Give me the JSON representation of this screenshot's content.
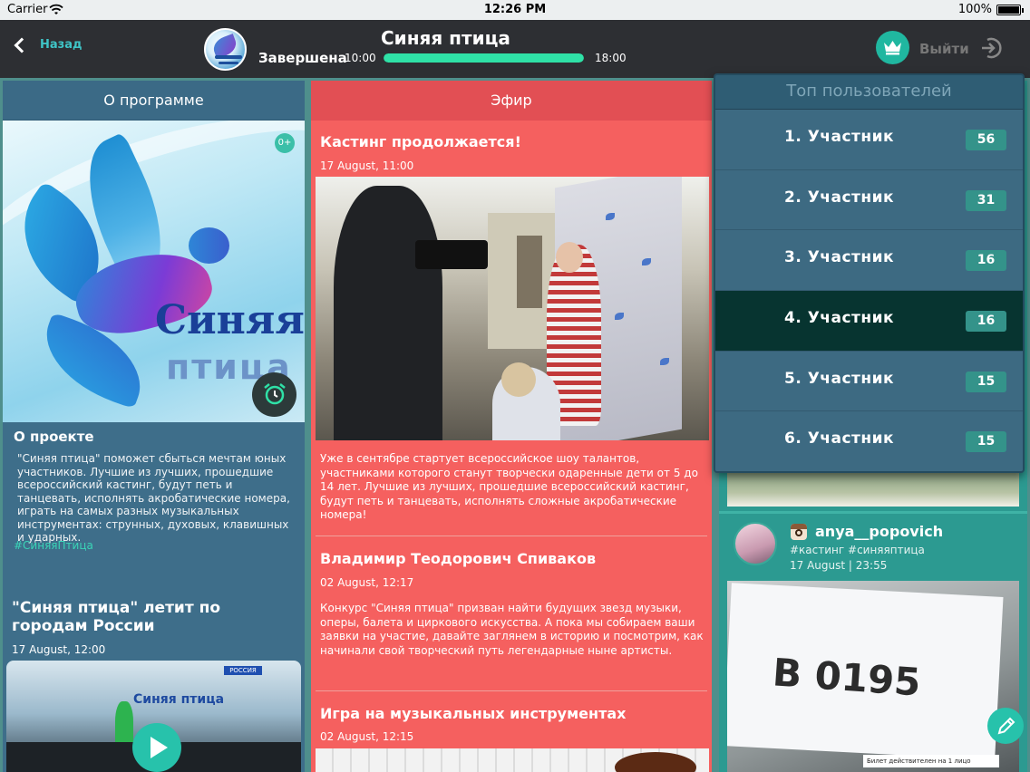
{
  "status_bar": {
    "carrier": "Carrier",
    "time": "12:26 PM",
    "battery": "100%"
  },
  "nav": {
    "back_label": "Назад",
    "show_title": "Синяя птица",
    "show_status": "Завершена",
    "time_start": "10:00",
    "time_end": "18:00",
    "progress": 1.0,
    "logout_label": "Выйти"
  },
  "about": {
    "header": "О программе",
    "age_rating": "0+",
    "poster_title_1": "Синяя",
    "poster_title_2": "птица",
    "section_title": "О проекте",
    "description": "\"Синяя птица\" поможет сбыться мечтам юных участников. Лучшие из лучших, прошедшие всероссийский кастинг, будут петь и танцевать, исполнять акробатические номера, играть на самых разных музыкальных инструментах: струнных, духовых, клавишных и ударных.",
    "hashtag": "#СиняяПтица",
    "news_title": "\"Синяя птица\" летит по городам России",
    "news_date": "17 August, 12:00",
    "video_logo": "Синяя птица",
    "video_channel": "РОССИЯ"
  },
  "air": {
    "header": "Эфир",
    "posts": [
      {
        "title": "Кастинг продолжается!",
        "date": "17 August, 11:00",
        "text": "Уже в сентябре стартует всероссийское шоу талантов, участниками которого станут творчески одаренные дети от 5 до 14 лет. Лучшие из лучших, прошедшие всероссийский кастинг, будут петь и танцевать, исполнять сложные акробатические номера!"
      },
      {
        "title": "Владимир Теодорович Спиваков",
        "date": "02 August, 12:17",
        "text": "Конкурс \"Синяя птица\" призван найти будущих звезд музыки, оперы, балета и циркового искусства. А пока мы собираем ваши заявки на участие, давайте заглянем в историю и посмотрим, как начинали свой творческий путь легендарные ныне артисты."
      },
      {
        "title": "Игра на музыкальных инструментах",
        "date": "02 August, 12:15"
      }
    ]
  },
  "social": {
    "username": "anya__popovich",
    "tags": "#кастинг #синяяптица",
    "date": "17 August | 23:55",
    "photo_code": "В 0195",
    "ticket_text": "Билет действителен на 1 лицо"
  },
  "top_users": {
    "header": "Топ пользователей",
    "items": [
      {
        "name": "1. Участник",
        "score": "56",
        "active": false
      },
      {
        "name": "2. Участник",
        "score": "31",
        "active": false
      },
      {
        "name": "3. Участник",
        "score": "16",
        "active": false
      },
      {
        "name": "4. Участник",
        "score": "16",
        "active": true
      },
      {
        "name": "5. Участник",
        "score": "15",
        "active": false
      },
      {
        "name": "6. Участник",
        "score": "15",
        "active": false
      }
    ]
  },
  "colors": {
    "accent": "#20b7a0",
    "progress": "#2fe1a7",
    "about_bg": "#3e6e8a",
    "air_bg": "#f5605f",
    "social_bg": "#2c9a91",
    "popover_bg": "#2f5d74",
    "active_row": "#073430"
  },
  "icons": [
    "wifi-icon",
    "back-chevron-icon",
    "crown-icon",
    "logout-icon",
    "alarm-clock-icon",
    "play-icon",
    "instagram-icon",
    "pencil-icon"
  ]
}
